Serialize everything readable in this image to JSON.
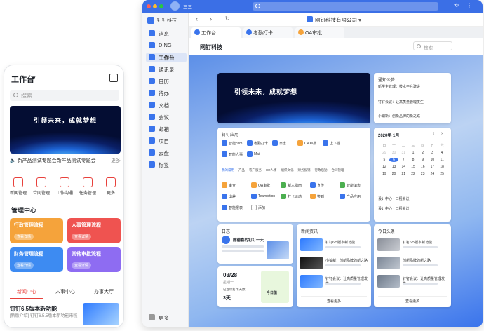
{
  "phone": {
    "title": "工作台",
    "search_placeholder": "搜索",
    "banner_text": "引领未来，成就梦想",
    "notice": "新产品测试专题会新产品测试专题会",
    "notice_more": "更多",
    "tools": [
      {
        "label": "新闻管理"
      },
      {
        "label": "合同管理"
      },
      {
        "label": "工作沟通"
      },
      {
        "label": "任务管理"
      },
      {
        "label": "更多"
      }
    ],
    "section_title": "管理中心",
    "cards": [
      {
        "title": "行政管理流程",
        "btn": "查看详情",
        "color": "#f5a33b"
      },
      {
        "title": "人事管理流程",
        "btn": "查看详情",
        "color": "#ef5350"
      },
      {
        "title": "财务管理流程",
        "btn": "查看详情",
        "color": "#3d8bf2"
      },
      {
        "title": "其他审批流程",
        "btn": "查看详情",
        "color": "#8e6cf2"
      }
    ],
    "tabs": [
      {
        "label": "新闻中心"
      },
      {
        "label": "人事中心"
      },
      {
        "label": "办事大厅"
      }
    ],
    "news_title": "钉钉6.5版本新功能",
    "news_desc": "[新版介绍] 钉钉6.5.5版本新功能来啦"
  },
  "desktop": {
    "app_name": "钉钉科技",
    "window_label": "三三",
    "org_name": "网钉科技有限公司",
    "nav": [
      {
        "label": "消息"
      },
      {
        "label": "DING"
      },
      {
        "label": "工作台"
      },
      {
        "label": "通讯录"
      },
      {
        "label": "日历"
      },
      {
        "label": "待办"
      },
      {
        "label": "文档"
      },
      {
        "label": "会议"
      },
      {
        "label": "邮箱"
      },
      {
        "label": "项目"
      },
      {
        "label": "云盘"
      },
      {
        "label": "标签"
      }
    ],
    "nav_more": "更多",
    "tabs": [
      {
        "label": "工作台"
      },
      {
        "label": "考勤打卡"
      },
      {
        "label": "OA审批"
      }
    ],
    "page_title": "网钉科技",
    "search_placeholder": "搜索",
    "banner_text": "引领未来，成就梦想",
    "notice_title": "通知公告",
    "notice_items": [
      {
        "text": "新学生管理：技术平台建设"
      },
      {
        "text": "钉钉会议：让高质量管理发生"
      },
      {
        "text": "小镇新：创新品牌的新之路"
      }
    ],
    "apps_title": "钉钉应用",
    "apps": [
      {
        "label": "智能com"
      },
      {
        "label": "考勤打卡"
      },
      {
        "label": "日志"
      },
      {
        "label": "OA审批"
      },
      {
        "label": "上下游"
      },
      {
        "label": "智能人事"
      },
      {
        "label": "Mail"
      }
    ],
    "common_tabs": [
      {
        "label": "我的常用"
      },
      {
        "label": "产品"
      },
      {
        "label": "客户服务"
      },
      {
        "label": "HR人事"
      },
      {
        "label": "组织文化"
      },
      {
        "label": "财务报销"
      },
      {
        "label": "行政后勤"
      },
      {
        "label": "合同管理"
      }
    ],
    "common_apps": [
      {
        "label": "审查"
      },
      {
        "label": "OA审批"
      },
      {
        "label": "新人指南"
      },
      {
        "label": "宣传"
      },
      {
        "label": "智能填表"
      },
      {
        "label": "出差"
      },
      {
        "label": "Teambition"
      },
      {
        "label": "打卡运动"
      },
      {
        "label": "签到"
      },
      {
        "label": "产品应用"
      },
      {
        "label": "智能报表"
      },
      {
        "label": "添加"
      }
    ],
    "calendar_title": "2020年 1月",
    "weekdays": [
      "日",
      "一",
      "二",
      "三",
      "四",
      "五",
      "六"
    ],
    "days": [
      "29",
      "30",
      "31",
      "1",
      "2",
      "3",
      "4",
      "5",
      "6",
      "7",
      "8",
      "9",
      "10",
      "11",
      "12",
      "13",
      "14",
      "15",
      "16",
      "17",
      "18",
      "19",
      "20",
      "21",
      "22",
      "23",
      "24",
      "25"
    ],
    "calendar_events": [
      {
        "text": "设计中心 · 日程会议"
      },
      {
        "text": "设计中心 · 日程会议"
      }
    ],
    "log_title": "日志",
    "log_text": "陈德喜的钉钉一天",
    "date_card": "03/28",
    "date_sub": "星期一",
    "streak_label": "已连续打卡天数",
    "streak_value": "3天",
    "today_label": "今日值",
    "news_title": "新闻资讯",
    "news_items": [
      {
        "text": "钉钉6.5版本新功能"
      },
      {
        "text": "小镇新：创新品牌的新之路"
      },
      {
        "text": "钉钉会议：让高质量管理发生"
      }
    ],
    "today_title": "今日头条",
    "today_items": [
      {
        "text": "钉钉6.5版本新功能"
      },
      {
        "text": "创新品牌的新之路"
      },
      {
        "text": "钉钉会议：让高质量管理发生"
      }
    ],
    "more_btn": "查看更多"
  }
}
